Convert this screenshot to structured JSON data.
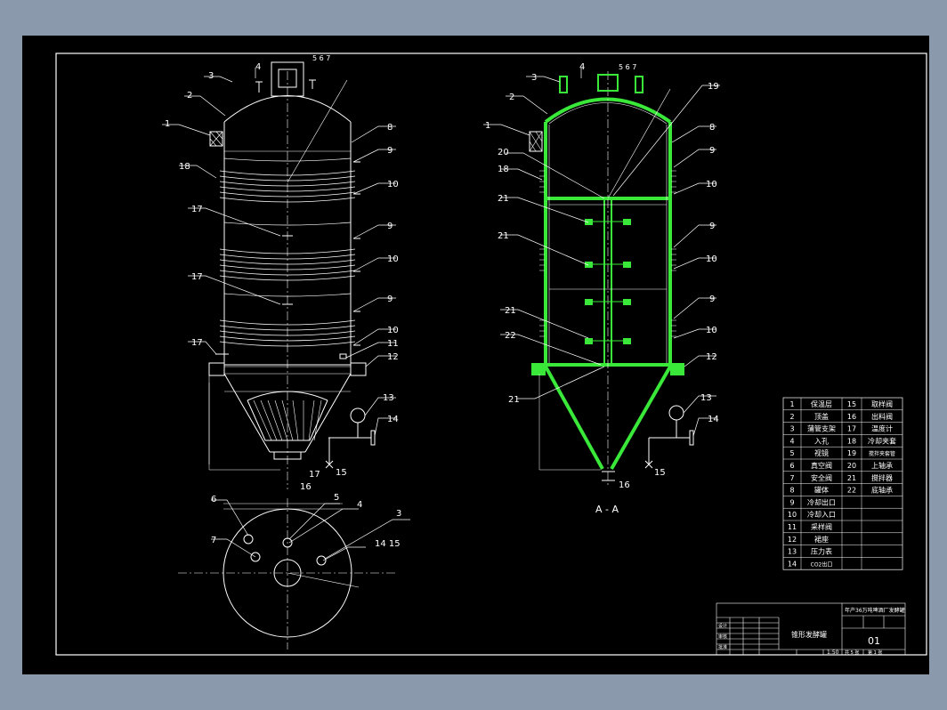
{
  "callouts": {
    "l1": "1",
    "l2": "2",
    "l3": "3",
    "l4": "4",
    "l567": "5  6  7",
    "l8": "8",
    "l9a": "9",
    "l10a": "10",
    "l9b": "9",
    "l10b": "10",
    "l9c": "9",
    "l10c": "10",
    "l11": "11",
    "l12": "12",
    "l13": "13",
    "l14": "14",
    "l15": "15",
    "l16": "16",
    "l17b": "17",
    "l17a": "17",
    "l17c": "17",
    "l17d": "17",
    "l18": "18",
    "r1": "1",
    "r2": "2",
    "r3": "3",
    "r4": "4",
    "r567": "5  6  7",
    "r8": "8",
    "r9a": "9",
    "r10a": "10",
    "r9b": "9",
    "r10b": "10",
    "r9c": "9",
    "r10c": "10",
    "r12": "12",
    "r13": "13",
    "r14": "14",
    "r15": "15",
    "r16": "16",
    "r18": "18",
    "r19": "19",
    "r20": "20",
    "r21a": "21",
    "r21b": "21",
    "r21c": "21",
    "r21d": "21",
    "r22": "22",
    "p3": "3",
    "p4": "4",
    "p5": "5",
    "p6": "6",
    "p7": "7",
    "p1415": "14  15"
  },
  "section_label": "A - A",
  "parts_list": [
    {
      "no": "1",
      "name": "保温层",
      "no2": "15",
      "name2": "取样阀"
    },
    {
      "no": "2",
      "name": "顶盖",
      "no2": "16",
      "name2": "出料阀"
    },
    {
      "no": "3",
      "name": "蒲管支架",
      "no2": "17",
      "name2": "温度计"
    },
    {
      "no": "4",
      "name": "入孔",
      "no2": "18",
      "name2": "冷却夹套"
    },
    {
      "no": "5",
      "name": "视镜",
      "no2": "19",
      "name2": "搅拌夹套管"
    },
    {
      "no": "6",
      "name": "真空阀",
      "no2": "20",
      "name2": "上轴承"
    },
    {
      "no": "7",
      "name": "安全阀",
      "no2": "21",
      "name2": "搅拌器"
    },
    {
      "no": "8",
      "name": "罐体",
      "no2": "22",
      "name2": "底轴承"
    },
    {
      "no": "9",
      "name": "冷却出口",
      "no2": "",
      "name2": ""
    },
    {
      "no": "10",
      "name": "冷却入口",
      "no2": "",
      "name2": ""
    },
    {
      "no": "11",
      "name": "采样阀",
      "no2": "",
      "name2": ""
    },
    {
      "no": "12",
      "name": "裙座",
      "no2": "",
      "name2": ""
    },
    {
      "no": "13",
      "name": "压力表",
      "no2": "",
      "name2": ""
    },
    {
      "no": "14",
      "name": "CO2出口",
      "no2": "",
      "name2": ""
    }
  ],
  "title_block": {
    "project": "年产36万吨啤酒厂发酵罐",
    "drawing_title": "锥形发酵罐",
    "drawing_no": "01",
    "scale": "1:50",
    "sheets": "共 5 张",
    "sheet": "第 1 张",
    "design_label": "设计",
    "check_label": "审核",
    "approve_label": "批准"
  }
}
